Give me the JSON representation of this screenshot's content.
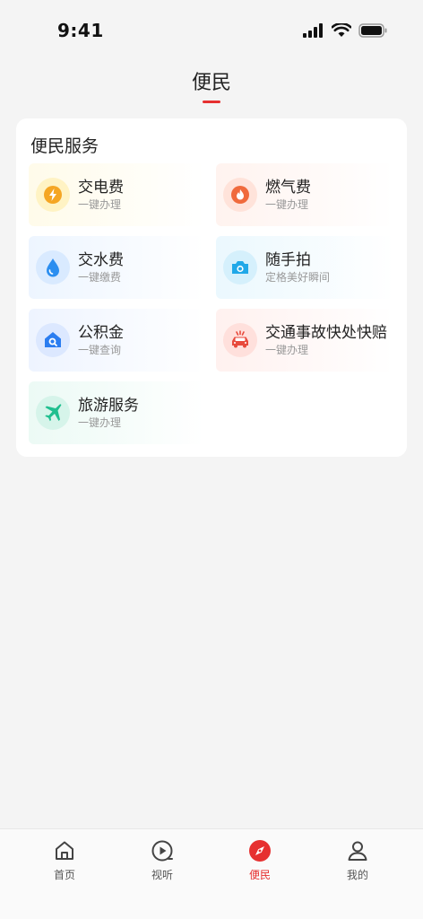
{
  "status": {
    "time": "9:41"
  },
  "header": {
    "title": "便民"
  },
  "section": {
    "title": "便民服务",
    "items": [
      {
        "title": "交电费",
        "subtitle": "一键办理",
        "icon": "lightning-icon"
      },
      {
        "title": "燃气费",
        "subtitle": "一键办理",
        "icon": "flame-icon"
      },
      {
        "title": "交水费",
        "subtitle": "一键缴费",
        "icon": "water-drop-icon"
      },
      {
        "title": "随手拍",
        "subtitle": "定格美好瞬间",
        "icon": "camera-icon"
      },
      {
        "title": "公积金",
        "subtitle": "一键查询",
        "icon": "house-search-icon"
      },
      {
        "title": "交通事故快处快赔",
        "subtitle": "一键办理",
        "icon": "car-accident-icon"
      },
      {
        "title": "旅游服务",
        "subtitle": "一键办理",
        "icon": "airplane-icon"
      }
    ]
  },
  "tabbar": {
    "items": [
      {
        "label": "首页",
        "icon": "home-icon"
      },
      {
        "label": "视听",
        "icon": "play-icon"
      },
      {
        "label": "便民",
        "icon": "compass-icon",
        "active": true
      },
      {
        "label": "我的",
        "icon": "user-icon"
      }
    ]
  },
  "colors": {
    "accent": "#e63030",
    "electric": "#f5a623",
    "gas": "#f06a3c",
    "water": "#2b8ef0",
    "camera": "#20a8e8",
    "fund": "#2b7df0",
    "accident": "#e84a3c",
    "travel": "#1fbf8f"
  }
}
